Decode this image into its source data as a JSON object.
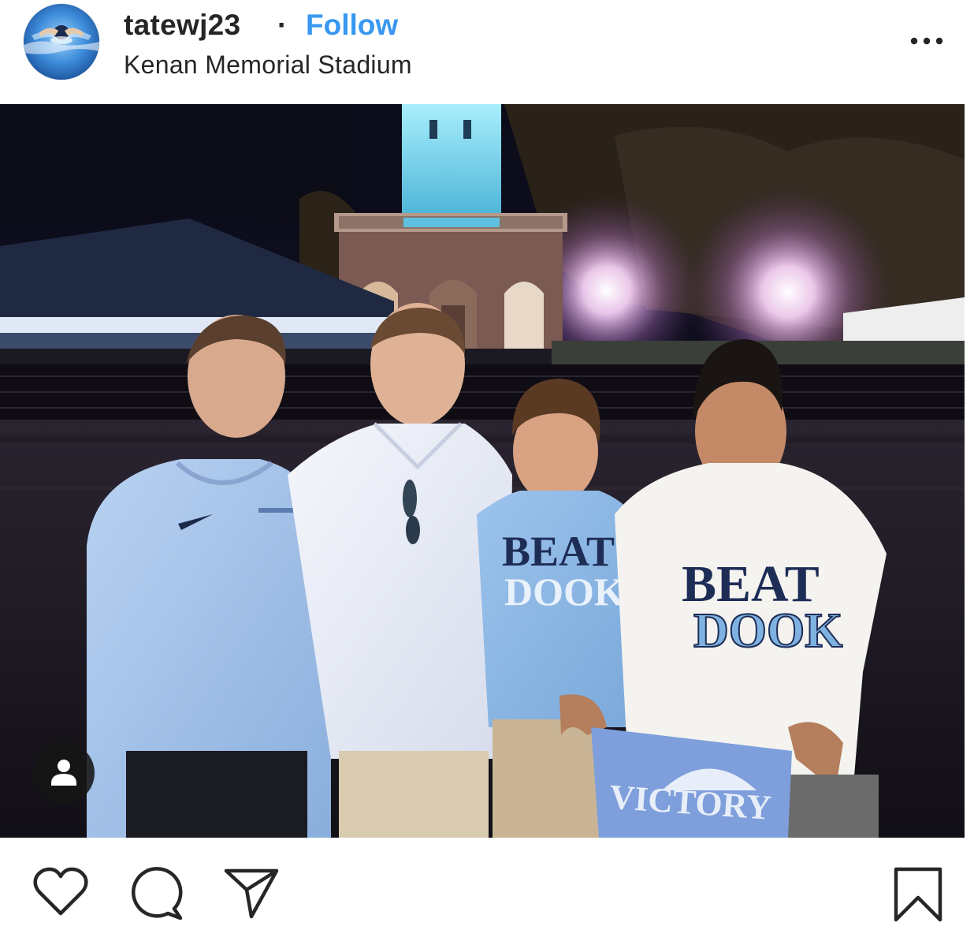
{
  "post_header": {
    "username": "tatewj23",
    "separator": "·",
    "follow_label": "Follow",
    "location": "Kenan Memorial Stadium"
  },
  "icons": {
    "avatar": "profile-photo-swimmer",
    "more": "more-options-icon",
    "user_tag": "user-tags-icon",
    "like": "heart-icon",
    "comment": "comment-bubble-icon",
    "share": "paper-plane-icon",
    "save": "bookmark-icon"
  },
  "photo": {
    "description_alt": "Four young men posing at night in front of an illuminated bell tower",
    "shirt_text_1": [
      "BEAT",
      "DOOK"
    ],
    "shirt_text_2": [
      "BEAT",
      "DOOK"
    ],
    "towel_text": "VICTORY"
  },
  "colors": {
    "follow_blue": "#3897f0",
    "text_dark": "#262626",
    "carolina_blue": "#7bafd4"
  }
}
